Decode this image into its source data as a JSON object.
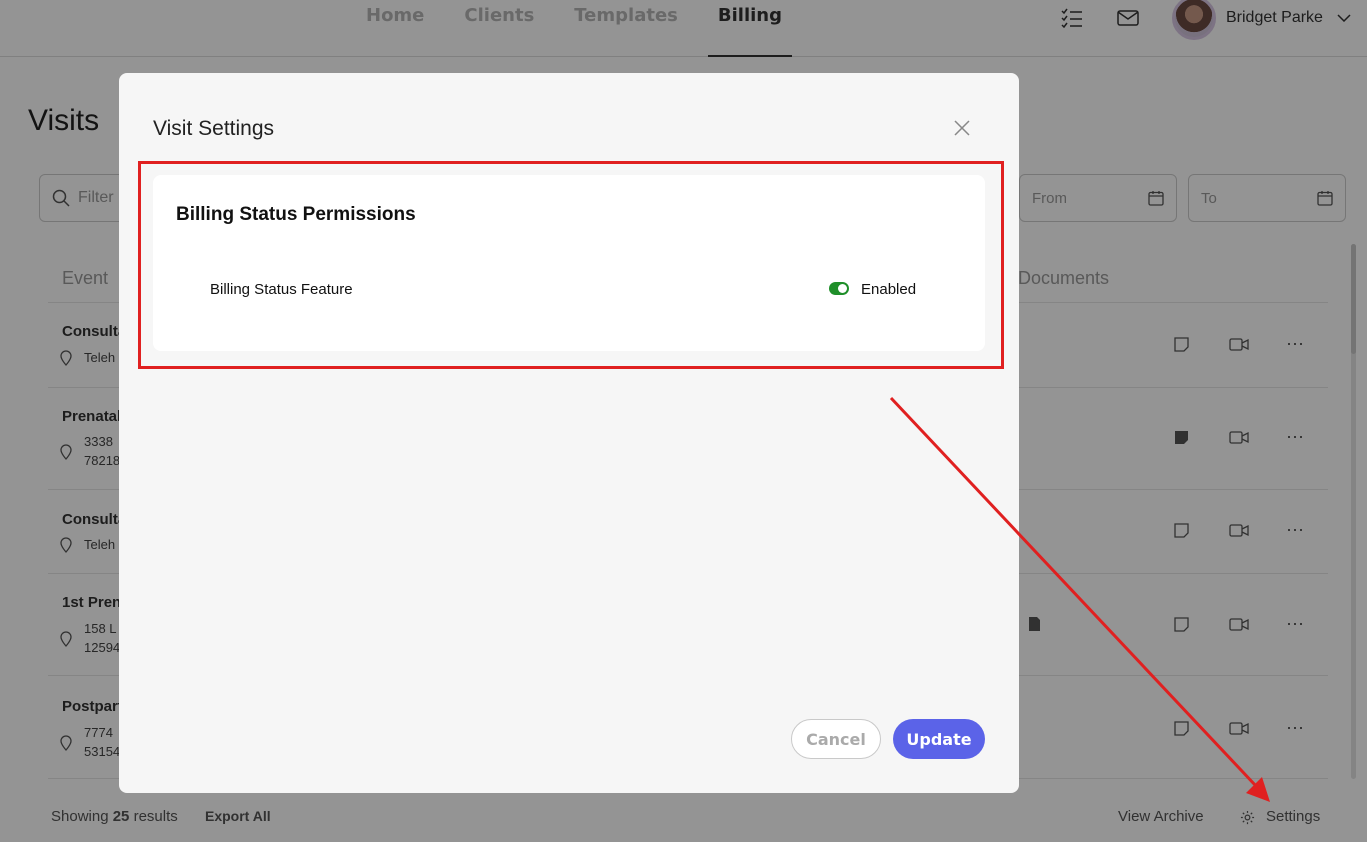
{
  "nav": {
    "tabs": [
      {
        "label": "Home"
      },
      {
        "label": "Clients"
      },
      {
        "label": "Templates"
      },
      {
        "label": "Billing"
      }
    ],
    "user_name": "Bridget Parke"
  },
  "page": {
    "title": "Visits",
    "filter_placeholder": "Filter",
    "from_label": "From",
    "to_label": "To",
    "columns": {
      "event": "Event",
      "documents": "Documents"
    },
    "rows": [
      {
        "title": "Consulta",
        "line1": "Teleh",
        "line2": ""
      },
      {
        "title": "Prenatal",
        "line1": "3338",
        "line2": "78218"
      },
      {
        "title": "Consulta",
        "line1": "Teleh",
        "line2": ""
      },
      {
        "title": "1st Pren",
        "line1": "158 L",
        "line2": "12594"
      },
      {
        "title": "Postpart",
        "line1": "7774",
        "line2": "53154"
      }
    ],
    "footer": {
      "showing_prefix": "Showing",
      "count": "25",
      "results": "results",
      "export": "Export All",
      "archive": "View Archive",
      "settings": "Settings"
    }
  },
  "modal": {
    "title": "Visit Settings",
    "section_title": "Billing Status Permissions",
    "feature_label": "Billing Status Feature",
    "toggle_state": "Enabled",
    "cancel_label": "Cancel",
    "update_label": "Update"
  },
  "colors": {
    "accent": "#5b63e8",
    "toggle_on": "#1f8f2a",
    "annotation": "#e02020"
  }
}
